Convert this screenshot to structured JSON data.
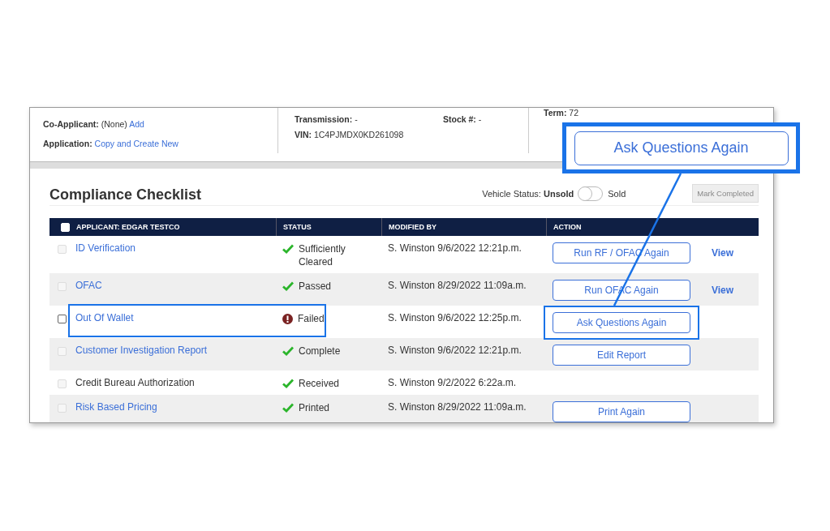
{
  "header": {
    "co_applicant": {
      "label": "Co-Applicant:",
      "value": "(None)",
      "link": "Add"
    },
    "application": {
      "label": "Application:",
      "link": "Copy and Create New"
    },
    "transmission": {
      "label": "Transmission:",
      "value": "-"
    },
    "stock": {
      "label": "Stock #:",
      "value": "-"
    },
    "vin": {
      "label": "VIN:",
      "value": "1C4PJMDX0KD261098"
    },
    "term": {
      "label": "Term:",
      "value": "72"
    }
  },
  "checklist": {
    "title": "Compliance Checklist",
    "vehicle_status": {
      "label": "Vehicle Status:",
      "value": "Unsold",
      "on": false,
      "toggle_label": "Sold"
    },
    "mark_completed": {
      "label": "Mark Completed",
      "disabled": true
    },
    "select_all": {
      "checked": false
    },
    "columns": [
      "APPLICANT: EDGAR TESTCO",
      "STATUS",
      "MODIFIED BY",
      "ACTION"
    ],
    "rows": [
      {
        "name": "ID Verification",
        "link": true,
        "checked": false,
        "disabled": true,
        "failed": false,
        "status": "Sufficiently Cleared",
        "modified": "S. Winston 9/6/2022 12:21p.m.",
        "action": "Run RF / OFAC Again",
        "view": "View",
        "highlighted": false
      },
      {
        "name": "OFAC",
        "link": true,
        "checked": false,
        "disabled": true,
        "failed": false,
        "status": "Passed",
        "modified": "S. Winston 8/29/2022 11:09a.m.",
        "action": "Run OFAC Again",
        "view": "View",
        "highlighted": false
      },
      {
        "name": "Out Of Wallet",
        "link": true,
        "checked": false,
        "disabled": false,
        "failed": true,
        "status": "Failed",
        "modified": "S. Winston 9/6/2022 12:25p.m.",
        "action": "Ask Questions Again",
        "highlighted": true
      },
      {
        "name": "Customer Investigation Report",
        "link": true,
        "checked": false,
        "disabled": true,
        "failed": false,
        "status": "Complete",
        "modified": "S. Winston 9/6/2022 12:21p.m.",
        "action": "Edit Report",
        "highlighted": false
      },
      {
        "name": "Credit Bureau Authorization",
        "link": false,
        "checked": false,
        "disabled": true,
        "failed": false,
        "status": "Received",
        "modified": "S. Winston 9/2/2022 6:22a.m.",
        "highlighted": false
      },
      {
        "name": "Risk Based Pricing",
        "link": true,
        "checked": false,
        "disabled": true,
        "failed": false,
        "status": "Printed",
        "modified": "S. Winston 8/29/2022 11:09a.m.",
        "action": "Print Again",
        "highlighted": false
      }
    ]
  },
  "callout": {
    "label": "Ask Questions Again"
  }
}
